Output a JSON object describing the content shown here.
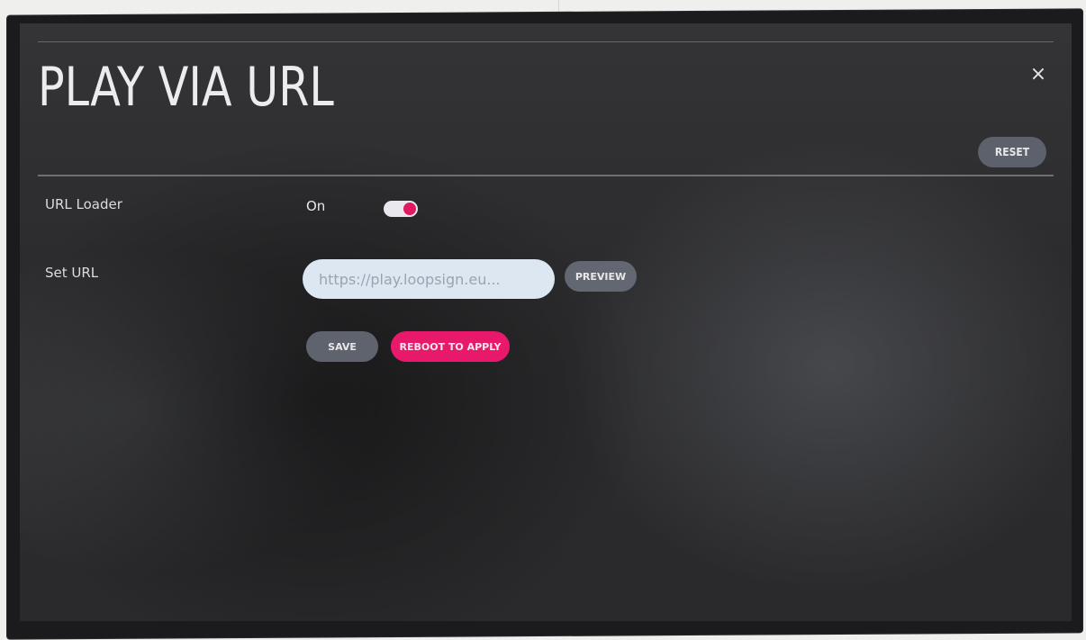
{
  "dialog": {
    "title": "PLAY VIA URL",
    "close_glyph": "×",
    "reset_label": "RESET"
  },
  "settings": {
    "url_loader": {
      "label": "URL Loader",
      "state_label": "On",
      "enabled": true
    },
    "set_url": {
      "label": "Set URL",
      "value": "https://play.loopsign.eu...",
      "preview_label": "PREVIEW"
    }
  },
  "actions": {
    "save_label": "SAVE",
    "reboot_label": "REBOOT TO APPLY"
  },
  "colors": {
    "accent": "#e8196a",
    "button_gray": "#5f636d",
    "input_bg": "#dde7f2"
  },
  "icons": {
    "close": "close-icon"
  }
}
